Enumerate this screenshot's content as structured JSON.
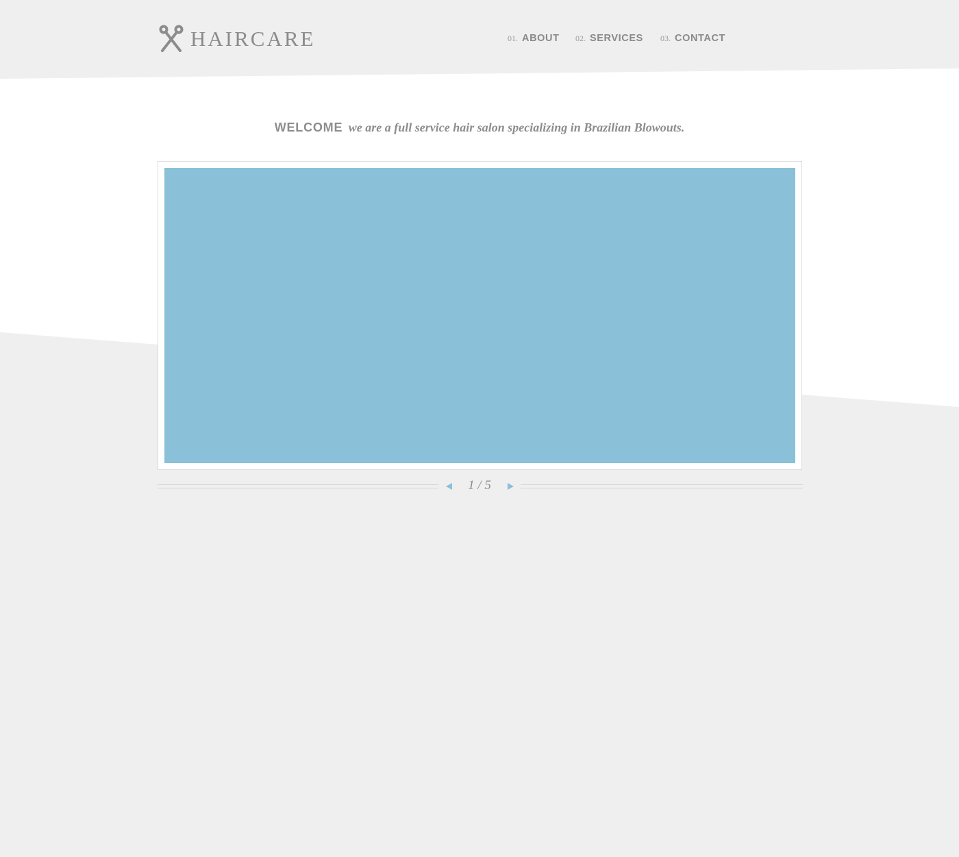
{
  "brand": {
    "name": "HAIRCARE",
    "icon": "scissors-icon"
  },
  "nav": {
    "items": [
      {
        "num": "01.",
        "label": "ABOUT"
      },
      {
        "num": "02.",
        "label": "SERVICES"
      },
      {
        "num": "03.",
        "label": "CONTACT"
      }
    ]
  },
  "welcome": {
    "heading": "WELCOME",
    "tagline": "we are a full service hair salon specializing in Brazilian Blowouts."
  },
  "slider": {
    "counter": "1 / 5",
    "current": 1,
    "total": 5,
    "prev_icon": "triangle-left-icon",
    "next_icon": "triangle-right-icon"
  },
  "colors": {
    "accent": "#8ac1d8",
    "text": "#8d8d8d",
    "background": "#efefef",
    "band": "#ffffff"
  }
}
